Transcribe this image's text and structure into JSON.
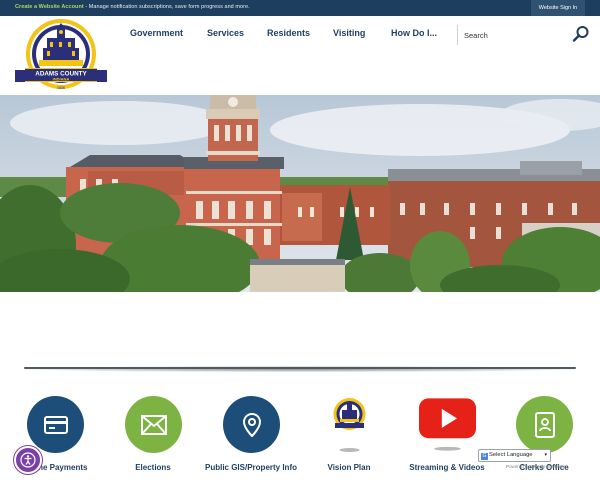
{
  "topbar": {
    "create_link": "Create a Website Account",
    "message": " - Manage notification subscriptions, save form progress and more.",
    "signin_label": "Website Sign In"
  },
  "logo": {
    "name_line1": "ADAMS COUNTY",
    "name_line2": "INDIANA",
    "est": "1836"
  },
  "nav": {
    "items": [
      {
        "label": "Government"
      },
      {
        "label": "Services"
      },
      {
        "label": "Residents"
      },
      {
        "label": "Visiting"
      },
      {
        "label": "How Do I..."
      }
    ]
  },
  "search": {
    "placeholder": "Search",
    "icon": "magnifier-icon"
  },
  "quick_links": [
    {
      "label": "Online Payments",
      "icon": "credit-card-icon",
      "color": "#1d4e79"
    },
    {
      "label": "Elections",
      "icon": "envelope-icon",
      "color": "#7cb342"
    },
    {
      "label": "Public GIS/Property Info",
      "icon": "map-pin-icon",
      "color": "#1d4e79"
    },
    {
      "label": "Vision Plan",
      "icon": "county-seal-icon",
      "color": "#ffffff"
    },
    {
      "label": "Streaming & Videos",
      "icon": "youtube-play-icon",
      "color": "#e62117"
    },
    {
      "label": "Clerks Office",
      "icon": "document-badge-icon",
      "color": "#7cb342"
    }
  ],
  "translate": {
    "label": "Select Language",
    "powered": "Powered by Google Translate"
  },
  "colors": {
    "brand_navy": "#1d3e5f",
    "accent_green": "#7cb342",
    "accessibility_purple": "#7b3fa5"
  }
}
